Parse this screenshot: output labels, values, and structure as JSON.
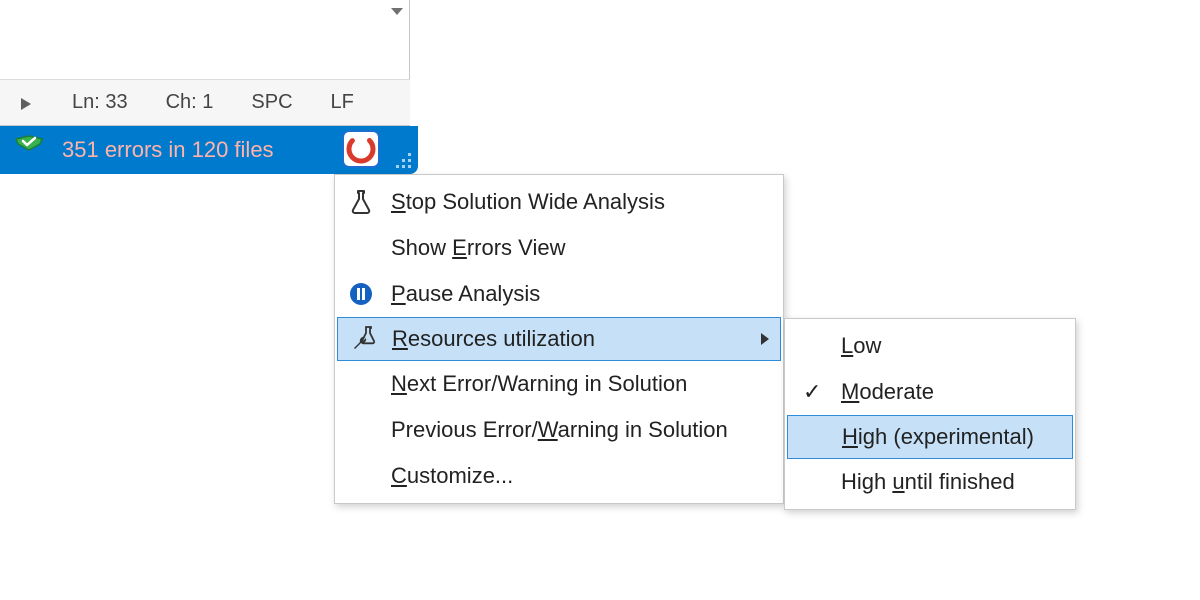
{
  "editor_status": {
    "line_prefix": "Ln: ",
    "line_value": "33",
    "col_prefix": "Ch: ",
    "col_value": "1",
    "indent": "SPC",
    "line_ending": "LF"
  },
  "bottom_bar": {
    "errors_text": "351 errors in 120 files"
  },
  "menu": {
    "stop": {
      "pre": "",
      "ul": "S",
      "post": "top Solution Wide Analysis"
    },
    "show_errors": {
      "pre": "Show ",
      "ul": "E",
      "post": "rrors View"
    },
    "pause": {
      "pre": "",
      "ul": "P",
      "post": "ause Analysis"
    },
    "resources": {
      "pre": "",
      "ul": "R",
      "post": "esources utilization"
    },
    "next": {
      "pre": "",
      "ul": "N",
      "post": "ext Error/Warning in Solution"
    },
    "previous": {
      "pre": "Previous Error/",
      "ul": "W",
      "post": "arning in Solution"
    },
    "customize": {
      "pre": "",
      "ul": "C",
      "post": "ustomize..."
    }
  },
  "submenu": {
    "low": {
      "pre": "",
      "ul": "L",
      "post": "ow"
    },
    "moderate": {
      "pre": "",
      "ul": "M",
      "post": "oderate"
    },
    "high": {
      "pre": "",
      "ul": "H",
      "post": "igh (experimental)"
    },
    "high_until": {
      "pre": "High ",
      "ul": "u",
      "post": "ntil finished"
    },
    "selected": "moderate",
    "highlighted": "high"
  }
}
